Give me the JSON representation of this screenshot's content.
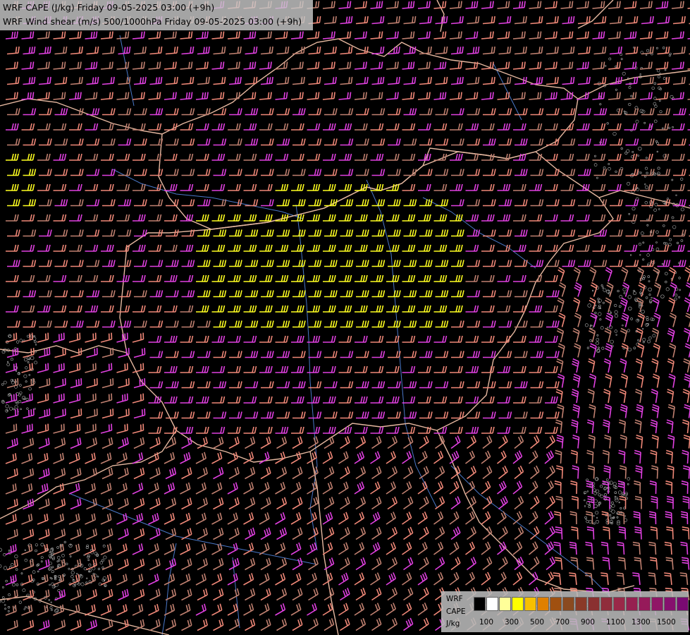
{
  "title_lines": [
    "WRF CAPE (J/kg) Friday 09-05-2025 03:00 (+9h)",
    "WRF Wind shear (m/s) 500/1000hPa Friday 09-05-2025 03:00 (+9h)"
  ],
  "legend": {
    "labels": [
      "WRF",
      "CAPE",
      "J/kg"
    ],
    "ticks": [
      "100",
      "300",
      "500",
      "700",
      "900",
      "1100",
      "1300",
      "1500"
    ],
    "colors": [
      "#000000",
      "#ffffff",
      "#ffff99",
      "#ffff00",
      "#f7c000",
      "#e08000",
      "#a05010",
      "#8a4a20",
      "#8a3a28",
      "#8a3030",
      "#902d3c",
      "#9a2848",
      "#962050",
      "#961a5a",
      "#901666",
      "#86106e",
      "#7a0a72"
    ]
  },
  "map_colors": {
    "background": "#000000",
    "border": "#e6b8a0",
    "river": "#4a78c8",
    "barb_low": "#c08070",
    "barb_mid": "#f08878",
    "barb_high": "#e040e0",
    "barb_max": "#ffff20",
    "terrain": "#b0b0b0"
  }
}
